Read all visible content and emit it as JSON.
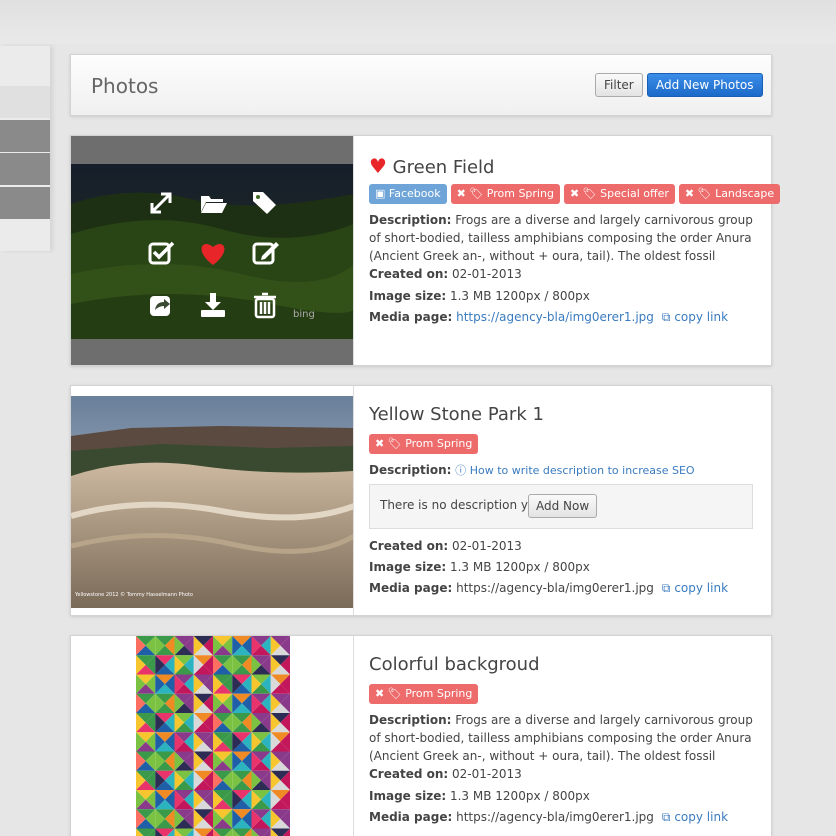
{
  "header": {
    "title": "Photos",
    "filter_label": "Filter",
    "add_label": "Add New Photos"
  },
  "labels": {
    "description": "Description:",
    "created": "Created on:",
    "size": "Image size:",
    "media": "Media page:",
    "copy": "copy link"
  },
  "cards": [
    {
      "title": "Green Field",
      "favorite": true,
      "tags": [
        {
          "label": "Facebook",
          "color": "#6fa4d8"
        },
        {
          "label": "Prom Spring",
          "color": "#ee6b6b"
        },
        {
          "label": "Special offer",
          "color": "#ee6b6b"
        },
        {
          "label": "Landscape",
          "color": "#ee6b6b"
        }
      ],
      "description": "Frogs are a diverse and largely carnivorous group of short-bodied, tailless amphibians composing the order Anura (Ancient Greek an-, without + oura, tail). The oldest fossil \"proto-frog\" appeared",
      "created": "02-01-2013",
      "size": "1.3 MB 1200px / 800px",
      "media": "https://agency-bla/img0erer1.jpg",
      "watermark": "bing"
    },
    {
      "title": "Yellow Stone Park 1",
      "tags": [
        {
          "label": "Prom Spring",
          "color": "#ee6b6b"
        }
      ],
      "help_link": "How to write description to increase SEO",
      "no_desc_text": "There is no description yet",
      "add_now": "Add Now",
      "created": "02-01-2013",
      "size": "1.3 MB 1200px / 800px",
      "media": "https://agency-bla/img0erer1.jpg",
      "caption": "Yellowstone 2012 © Tommy Hasselmann Photo"
    },
    {
      "title": "Colorful backgroud",
      "tags": [
        {
          "label": "Prom Spring",
          "color": "#ee6b6b"
        }
      ],
      "description": "Frogs are a diverse and largely carnivorous group of short-bodied, tailless amphibians composing the order Anura (Ancient Greek an-, without + oura, tail). The oldest fossil \"proto-frog\" appeared",
      "created": "02-01-2013",
      "size": "1.3 MB 1200px / 800px",
      "media": "https://agency-bla/img0erer1.jpg"
    }
  ]
}
